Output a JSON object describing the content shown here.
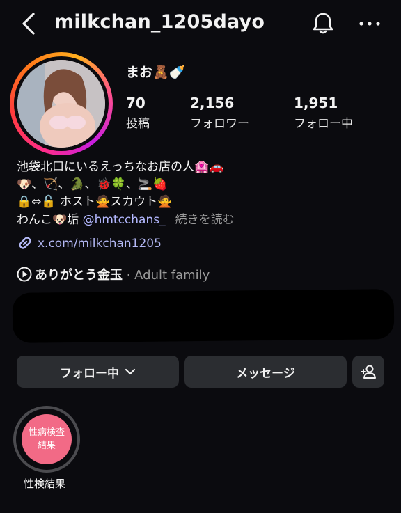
{
  "header": {
    "username": "milkchan_1205dayo",
    "back_icon": "chevron-left-icon",
    "bell_icon": "bell-icon",
    "more_icon": "more-horizontal-icon"
  },
  "profile": {
    "display_name": "まお🧸🍼",
    "stats": [
      {
        "value": "70",
        "label": "投稿"
      },
      {
        "value": "2,156",
        "label": "フォロワー"
      },
      {
        "value": "1,951",
        "label": "フォロー中"
      }
    ]
  },
  "bio": {
    "line1": "池袋北口にいるえっちなお店の人🏩🚗",
    "line2": "🐶、🏹、🐊、🐞🍀、🚬🍓",
    "line3": "🔒⇔🔓 ホスト🙅スカウト🙅",
    "line4_prefix": "わんこ🐶垢 ",
    "mention": "@hmtcchans_",
    "more": "続きを読む",
    "link_text": "x.com/milkchan1205"
  },
  "music": {
    "title": "ありがとう金玉",
    "artist": " · Adult family"
  },
  "buttons": {
    "following": "フォロー中",
    "message": "メッセージ"
  },
  "highlights": [
    {
      "circle_line1": "性病検査",
      "circle_line2": "結果",
      "label": "性検結果"
    }
  ],
  "colors": {
    "background": "#0b0b0f",
    "button": "#2b2d31",
    "link": "#b4b9f5",
    "highlight": "#f26a86"
  }
}
